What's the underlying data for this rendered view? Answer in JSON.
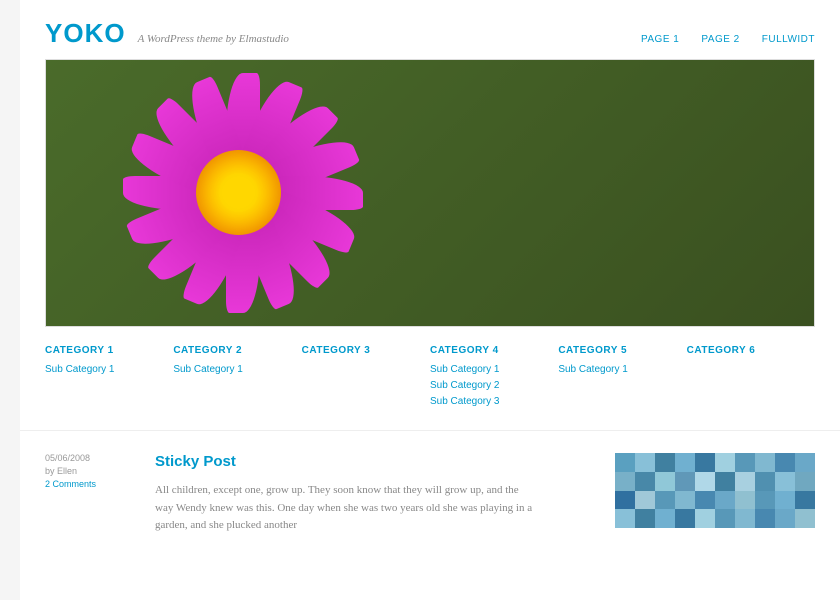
{
  "site": {
    "title": "YOKO",
    "tagline": "A WordPress theme by Elmastudio"
  },
  "topnav": [
    {
      "label": "PAGE 1"
    },
    {
      "label": "PAGE 2"
    },
    {
      "label": "FULLWIDT"
    }
  ],
  "categories": [
    {
      "title": "CATEGORY 1",
      "subs": [
        "Sub Category 1"
      ]
    },
    {
      "title": "CATEGORY 2",
      "subs": [
        "Sub Category 1"
      ]
    },
    {
      "title": "CATEGORY 3",
      "subs": []
    },
    {
      "title": "CATEGORY 4",
      "subs": [
        "Sub Category 1",
        "Sub Category 2",
        "Sub Category 3"
      ]
    },
    {
      "title": "CATEGORY 5",
      "subs": [
        "Sub Category 1"
      ]
    },
    {
      "title": "CATEGORY 6",
      "subs": []
    }
  ],
  "post": {
    "meta": {
      "date": "05/06/2008",
      "author": "by Ellen",
      "comments": "2 Comments"
    },
    "title": "Sticky Post",
    "body": "All children, except one, grow up. They soon know that they will grow up, and the way Wendy knew was this. One day when she was two years old she was playing in a garden, and she plucked another"
  },
  "colors": {
    "accent": "#0099cc",
    "pixels": [
      "#5aa0c0",
      "#88c0d8",
      "#4080a0",
      "#70b0d0",
      "#3878a0",
      "#a0d0e0",
      "#5898b8",
      "#80b8d0",
      "#4888b0",
      "#6aa8c8",
      "#78b0c8",
      "#4888a8",
      "#90c8d8",
      "#6098b8",
      "#b0d8e8",
      "#4080a0",
      "#a8d0e0",
      "#5090b0",
      "#88c0d8",
      "#70a8c0",
      "#3070a0",
      "#a0c8d8",
      "#5898b8",
      "#80b8d0",
      "#4888b0",
      "#6aa8c8",
      "#90c0d0",
      "#5898b8",
      "#70b0d0",
      "#3878a0",
      "#88c0d8",
      "#4080a0",
      "#70b0d0",
      "#3878a0",
      "#a0d0e0",
      "#5898b8",
      "#80b8d0",
      "#4888b0",
      "#6aa8c8",
      "#90c0d0"
    ]
  }
}
